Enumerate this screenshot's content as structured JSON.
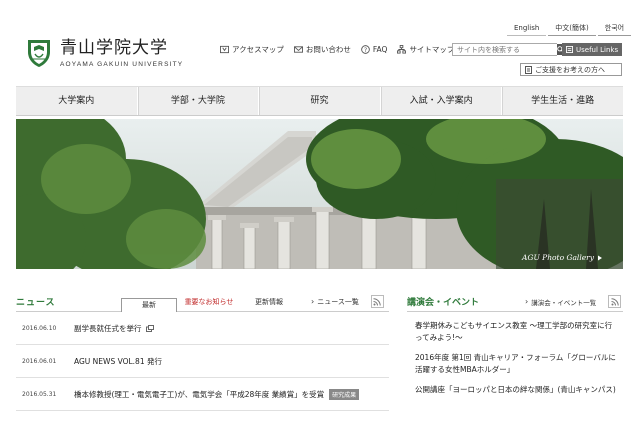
{
  "header": {
    "logo_jp": "青山学院大学",
    "logo_en": "AOYAMA GAKUIN UNIVERSITY",
    "languages": [
      "English",
      "中文(簡体)",
      "한국어"
    ],
    "utility_links": [
      {
        "label": "アクセスマップ",
        "icon": "map-pin-icon"
      },
      {
        "label": "お問い合わせ",
        "icon": "mail-icon"
      },
      {
        "label": "FAQ",
        "icon": "question-icon"
      },
      {
        "label": "サイトマップ",
        "icon": "sitemap-icon"
      }
    ],
    "search_placeholder": "サイト内を検索する",
    "useful_forms": "Useful Links",
    "opinion_label": "ご支援をお考えの方へ"
  },
  "global_nav": [
    "大学案内",
    "学部・大学院",
    "研究",
    "入試・入学案内",
    "学生生活・進路"
  ],
  "hero": {
    "gallery_label": "AGU Photo Gallery"
  },
  "news": {
    "title": "ニュース",
    "tabs": [
      "最新",
      "重要なお知らせ",
      "更新情報"
    ],
    "list_link": "ニュース一覧",
    "items": [
      {
        "date": "2016.06.10",
        "text": "副学長就任式を挙行",
        "external": true,
        "badge": ""
      },
      {
        "date": "2016.06.01",
        "text": "AGU NEWS VOL.81 発行",
        "external": false,
        "badge": ""
      },
      {
        "date": "2016.05.31",
        "text": "橋本修教授(理工・電気電子工)が、電気学会「平成28年度 業績賞」を受賞",
        "external": false,
        "badge": "研究成果"
      }
    ]
  },
  "events": {
    "title": "講演会・イベント",
    "list_link": "講演会・イベント一覧",
    "items": [
      "春学期休みこどもサイエンス教室 ～理工学部の研究室に行ってみよう!～",
      "2016年度 第1回 青山キャリア・フォーラム「グローバルに活躍する女性MBAホルダー」",
      "公開講座「ヨーロッパと日本の絆な関係」(青山キャンパス)"
    ]
  },
  "colors": {
    "accent_green": "#2f7a3b",
    "important_red": "#c12a2a",
    "nav_bg": "#eeeeee"
  }
}
